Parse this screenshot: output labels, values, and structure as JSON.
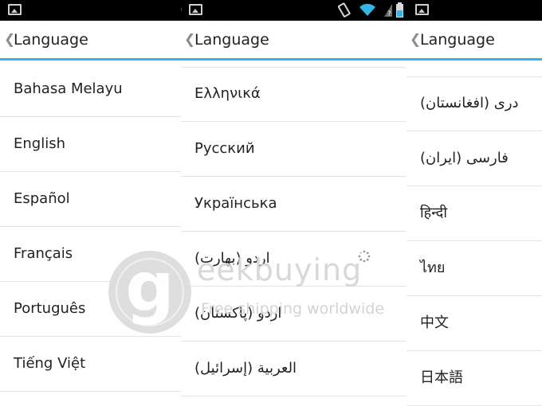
{
  "panels": [
    {
      "title": "Language",
      "items": [
        "Bahasa Melayu",
        "English",
        "Español",
        "Français",
        "Português",
        "Tiếng Việt"
      ]
    },
    {
      "title": "Language",
      "items": [
        "Ελληνικά",
        "Русский",
        "Українська",
        "اردو (بھارت)",
        "اردو (پاکستان)",
        "العربية (إسرائيل)"
      ]
    },
    {
      "title": "Language",
      "items": [
        "دری (افغانستان)",
        "فارسی (ایران)",
        "हिन्दी",
        "ไทย",
        "中文",
        "日本語"
      ]
    }
  ],
  "watermark": {
    "brand_rest": "eekbuying",
    "tagline": "Free shipping worldwide"
  },
  "colors": {
    "accent": "#33b5e5",
    "statusbar": "#000000"
  }
}
